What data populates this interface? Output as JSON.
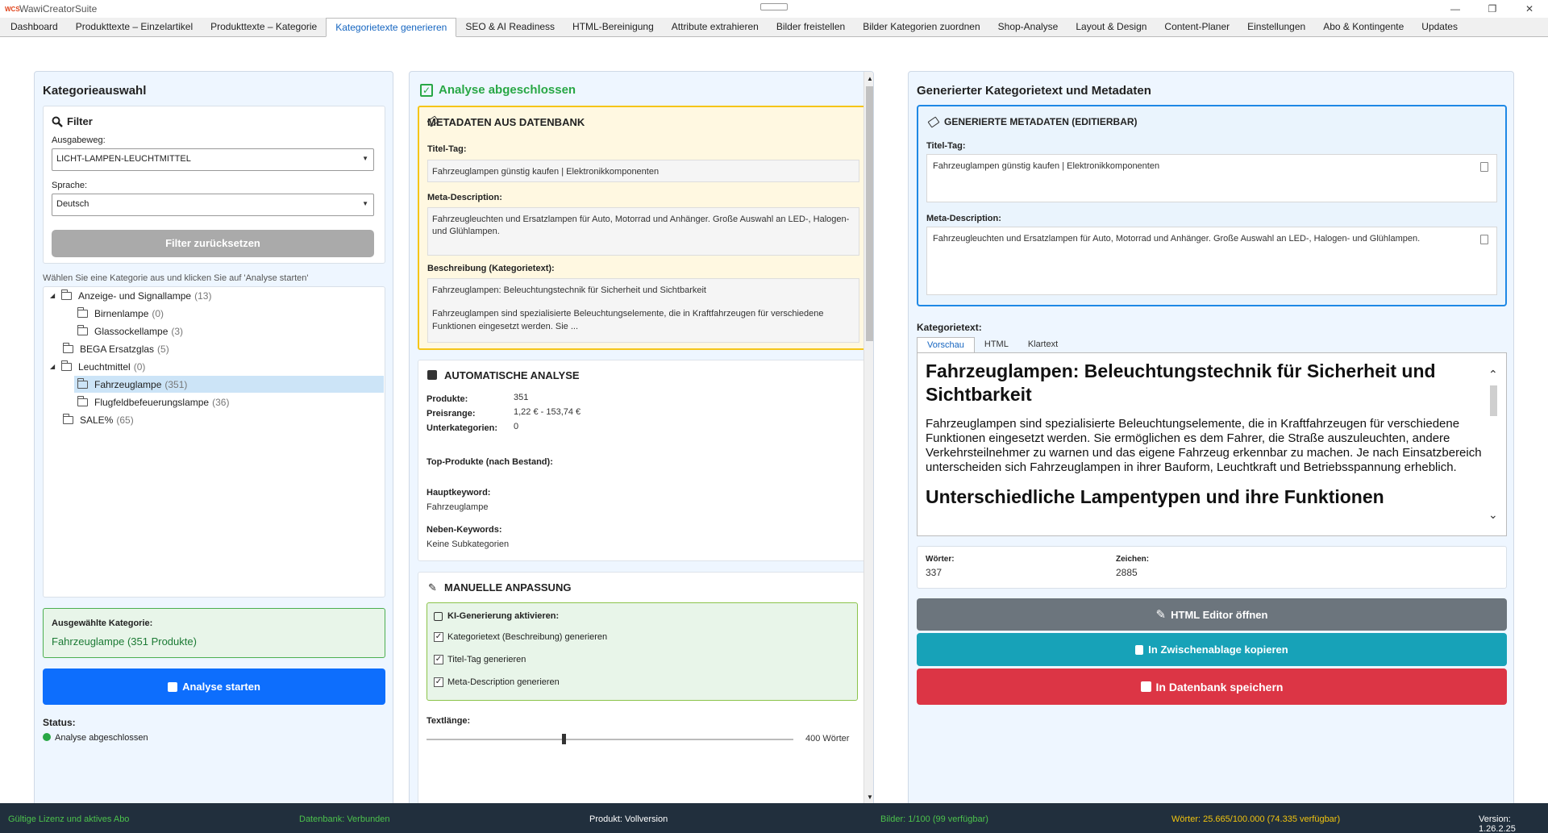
{
  "window": {
    "logo": "WCS",
    "title": "WawiCreatorSuite",
    "controls": [
      "—",
      "❐",
      "✕"
    ]
  },
  "tabs": [
    "Dashboard",
    "Produkttexte – Einzelartikel",
    "Produkttexte – Kategorie",
    "Kategorietexte generieren",
    "SEO & AI Readiness",
    "HTML-Bereinigung",
    "Attribute extrahieren",
    "Bilder freistellen",
    "Bilder Kategorien zuordnen",
    "Shop-Analyse",
    "Layout & Design",
    "Content-Planer",
    "Einstellungen",
    "Abo & Kontingente",
    "Updates"
  ],
  "left": {
    "title": "Kategorieauswahl",
    "filter": {
      "title": "Filter",
      "ausgabeweg_label": "Ausgabeweg:",
      "ausgabeweg_value": "LICHT-LAMPEN-LEUCHTMITTEL",
      "sprache_label": "Sprache:",
      "sprache_value": "Deutsch",
      "reset_label": "Filter zurücksetzen"
    },
    "hint": "Wählen Sie eine Kategorie aus und klicken Sie auf 'Analyse starten'",
    "tree": [
      {
        "label": "Anzeige- und Signallampe",
        "count": "(13)",
        "expanded": true
      },
      {
        "label": "Birnenlampe",
        "count": "(0)"
      },
      {
        "label": "Glassockellampe",
        "count": "(3)"
      },
      {
        "label": "BEGA Ersatzglas",
        "count": "(5)"
      },
      {
        "label": "Leuchtmittel",
        "count": "(0)",
        "expanded": true
      },
      {
        "label": "Fahrzeuglampe",
        "count": "(351)",
        "selected": true
      },
      {
        "label": "Flugfeldbefeuerungslampe",
        "count": "(36)"
      },
      {
        "label": "SALE%",
        "count": "(65)"
      }
    ],
    "selected_label": "Ausgewählte Kategorie:",
    "selected_value": "Fahrzeuglampe (351 Produkte)",
    "analyse_button": "Analyse starten",
    "status_label": "Status:",
    "status_value": "Analyse abgeschlossen"
  },
  "middle": {
    "header": "Analyse abgeschlossen",
    "meta": {
      "title": "Metadaten aus Datenbank",
      "title_tag_label": "Titel-Tag:",
      "title_tag": "Fahrzeuglampen günstig kaufen | Elektronikkomponenten",
      "meta_desc_label": "Meta-Description:",
      "meta_desc": "Fahrzeugleuchten und Ersatzlampen für Auto, Motorrad und Anhänger. Große Auswahl an LED-, Halogen- und Glühlampen.",
      "desc_label": "Beschreibung (Kategorietext):",
      "desc_line1": "Fahrzeuglampen: Beleuchtungstechnik für Sicherheit und Sichtbarkeit",
      "desc_line2": "Fahrzeuglampen sind spezialisierte Beleuchtungselemente, die in Kraftfahrzeugen für verschiedene Funktionen eingesetzt werden. Sie ..."
    },
    "analysis": {
      "title": "Automatische Analyse",
      "produkte_label": "Produkte:",
      "produkte": "351",
      "preis_label": "Preisrange:",
      "preis": "1,22 € - 153,74 €",
      "unter_label": "Unterkategorien:",
      "unter": "0",
      "top_label": "Top-Produkte (nach Bestand):",
      "haupt_label": "Hauptkeyword:",
      "haupt": "Fahrzeuglampe",
      "neben_label": "Neben-Keywords:",
      "neben": "Keine Subkategorien"
    },
    "manual": {
      "title": "Manuelle Anpassung",
      "ki_label": "KI-Generierung aktivieren:",
      "options": [
        "Kategorietext (Beschreibung) generieren",
        "Titel-Tag generieren",
        "Meta-Description generieren"
      ],
      "length_label": "Textlänge:",
      "length_value": "400 Wörter",
      "length_fraction": 0.37
    }
  },
  "right": {
    "title": "Generierter Kategorietext und Metadaten",
    "meta_title": "Generierte Metadaten (editierbar)",
    "title_tag_label": "Titel-Tag:",
    "title_tag": "Fahrzeuglampen günstig kaufen | Elektronikkomponenten",
    "meta_desc_label": "Meta-Description:",
    "meta_desc": "Fahrzeugleuchten und Ersatzlampen für Auto, Motorrad und Anhänger. Große Auswahl an LED-, Halogen- und Glühlampen.",
    "text_label": "Kategorietext:",
    "view_tabs": [
      "Vorschau",
      "HTML",
      "Klartext"
    ],
    "preview_h1": "Fahrzeuglampen: Beleuchtungstechnik für Sicherheit und Sichtbarkeit",
    "preview_p": "Fahrzeuglampen sind spezialisierte Beleuchtungselemente, die in Kraftfahrzeugen für verschiedene Funktionen eingesetzt werden. Sie ermöglichen es dem Fahrer, die Straße auszuleuchten, andere Verkehrsteilnehmer zu warnen und das eigene Fahrzeug erkennbar zu machen. Je nach Einsatzbereich unterscheiden sich Fahrzeuglampen in ihrer Bauform, Leuchtkraft und Betriebsspannung erheblich.",
    "preview_h2": "Unterschiedliche Lampentypen und ihre Funktionen",
    "words_label": "Wörter:",
    "words": "337",
    "chars_label": "Zeichen:",
    "chars": "2885",
    "btn_editor": "HTML Editor öffnen",
    "btn_copy": "In Zwischenablage kopieren",
    "btn_save": "In Datenbank speichern"
  },
  "statusbar": {
    "license": "Gültige Lizenz und aktives Abo",
    "db": "Datenbank: Verbunden",
    "product": "Produkt: Vollversion",
    "images": "Bilder: 1/100 (99 verfügbar)",
    "words": "Wörter: 25.665/100.000 (74.335 verfügbar)",
    "version": "Version: 1.26.2.25"
  },
  "colors": {
    "accent": "#1565c0",
    "primary": "#0d6efd",
    "success": "#28a745",
    "info": "#17a2b8",
    "danger": "#dc3545",
    "secondary": "#6c757d"
  }
}
